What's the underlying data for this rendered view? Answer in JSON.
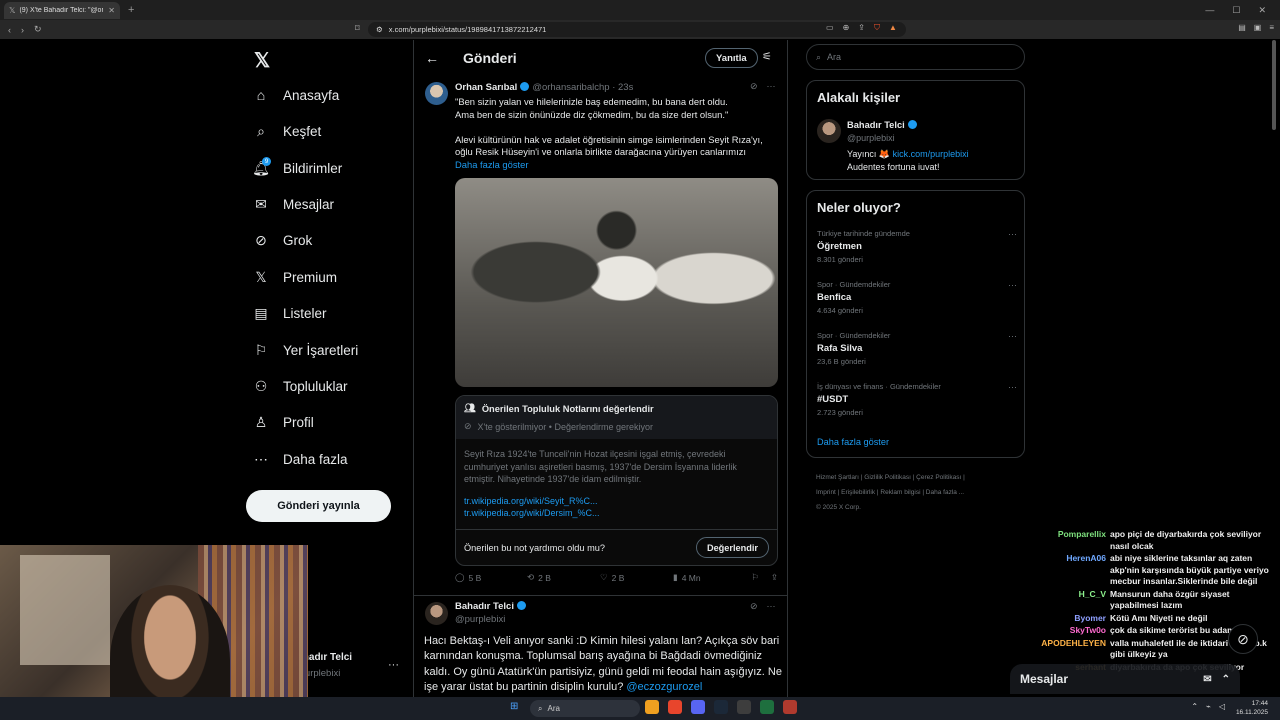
{
  "browser": {
    "tab_title": "(9) X'te Bahadır Telci: \"@orhansaribalchp ...",
    "url": "x.com/purplebixi/status/1989841713872212471"
  },
  "nav": {
    "items": [
      {
        "label": "Anasayfa",
        "icon": "home-icon"
      },
      {
        "label": "Keşfet",
        "icon": "search-icon"
      },
      {
        "label": "Bildirimler",
        "icon": "bell-icon",
        "badge": "9"
      },
      {
        "label": "Mesajlar",
        "icon": "mail-icon"
      },
      {
        "label": "Grok",
        "icon": "grok-icon"
      },
      {
        "label": "Premium",
        "icon": "x-logo-icon"
      },
      {
        "label": "Listeler",
        "icon": "list-icon"
      },
      {
        "label": "Yer İşaretleri",
        "icon": "bookmark-icon"
      },
      {
        "label": "Topluluklar",
        "icon": "communities-icon"
      },
      {
        "label": "Profil",
        "icon": "person-icon"
      },
      {
        "label": "Daha fazla",
        "icon": "more-circle-icon"
      }
    ],
    "post_button": "Gönderi yayınla",
    "account_name": "Bahadır Telci",
    "account_handle": "@purplebixi"
  },
  "main": {
    "header_title": "Gönderi",
    "reply_button": "Yanıtla",
    "tweet1": {
      "name": "Orhan Sarıbal",
      "handle": "@orhansaribalchp",
      "time": "23s",
      "text_line1": "\"Ben sizin yalan ve hilelerinizle baş edemedim, bu bana dert oldu.",
      "text_line2": "Ama ben de sizin önünüzde diz çökmedim, bu da size dert olsun.\"",
      "text_line3": "Alevi kültürünün hak ve adalet öğretisinin simge isimlerinden Seyit Rıza'yı,",
      "text_line4": "oğlu Resik Hüseyin'i ve onlarla birlikte darağacına yürüyen canlarımızı",
      "show_more": "Daha fazla göster"
    },
    "note": {
      "title": "Önerilen Topluluk Notlarını değerlendir",
      "subtitle": "X'te gösterilmiyor • Değerlendirme gerekiyor",
      "body_line1": "Seyit Rıza 1924'te Tunceli'nin Hozat ilçesini işgal etmiş, çevredeki",
      "body_line2": "cumhuriyet yanlısı aşiretleri basmış, 1937'de Dersim İsyanına liderlik",
      "body_line3": "etmiştir. Nihayetinde 1937'de idam edilmiştir.",
      "link1": "tr.wikipedia.org/wiki/Seyit_R%C...",
      "link2": "tr.wikipedia.org/wiki/Dersim_%C...",
      "question": "Önerilen bu not yardımcı oldu mu?",
      "rate_button": "Değerlendir"
    },
    "actions": {
      "replies": "5 B",
      "reposts": "2 B",
      "likes": "2 B",
      "views": "4 Mn"
    },
    "tweet2": {
      "name": "Bahadır Telci",
      "handle": "@purplebixi",
      "text": "Hacı Bektaş-ı Veli anıyor sanki :D Kimin hilesi yalanı lan? Açıkça söv bari karnından konuşma. Toplumsal barış ayağına bi Bağdadi övmediğiniz kaldı. Oy günü Atatürk'ün partisiyiz, günü geldi mi feodal hain aşığıyız. Ne işe yarar üstat bu partinin disiplin kurulu?",
      "mention": "@eczozgurozel"
    }
  },
  "right": {
    "search_placeholder": "Ara",
    "related_title": "Alakalı kişiler",
    "related": {
      "name": "Bahadır Telci",
      "handle": "@purplebixi",
      "bio_prefix": "Yayıncı 🦊",
      "bio_link": "kick.com/purplebixi",
      "bio_line2": "Audentes fortuna iuvat!"
    },
    "trends_title": "Neler oluyor?",
    "trends": [
      {
        "category": "Türkiye tarihinde gündemde",
        "name": "Öğretmen",
        "count": "8.301 gönderi"
      },
      {
        "category": "Spor · Gündemdekiler",
        "name": "Benfica",
        "count": "4.634 gönderi"
      },
      {
        "category": "Spor · Gündemdekiler",
        "name": "Rafa Silva",
        "count": "23,6 B gönderi"
      },
      {
        "category": "İş dünyası ve finans · Gündemdekiler",
        "name": "#USDT",
        "count": "2.723 gönderi"
      }
    ],
    "show_more": "Daha fazla göster",
    "footer_line1": "Hizmet Şartları  |  Gizlilik Politikası  |  Çerez Politikası  |",
    "footer_line2": "Imprint  |  Erişilebilirlik  |  Reklam bilgisi  |  Daha fazla ...",
    "footer_line3": "© 2025 X Corp."
  },
  "chat": [
    {
      "user": "Pomparellix",
      "color": "#7ee07e",
      "msg": "apo piçi de diyarbakırda çok seviliyor nasıl olcak"
    },
    {
      "user": "HerenA06",
      "color": "#6fa8ff",
      "msg": "abi niye siklerine taksınlar aq zaten akp'nin karşısında büyük partiye veriyo mecbur insanlar.Siklerinde bile değil"
    },
    {
      "user": "H_C_V",
      "color": "#8df28d",
      "msg": "Mansurun daha özgür siyaset yapabilmesi lazım"
    },
    {
      "user": "Byomer",
      "color": "#8fa0ff",
      "msg": "Kötü Amı Niyeti ne değil"
    },
    {
      "user": "SkyTw0o",
      "color": "#ff6bd0",
      "msg": "çok da sikime terörist bu adam"
    },
    {
      "user": "APODEHLEYEN",
      "color": "#ffb347",
      "msg": "valla muhalefetl ile de iktidari ile de b.k gibi ülkeyiz ya"
    },
    {
      "user": "serhant",
      "color": "#ffd27a",
      "msg": "diyarbakırda da apo çok seviliyor"
    }
  ],
  "messages_label": "Mesajlar",
  "taskbar": {
    "search": "Ara",
    "time": "17:44",
    "date": "16.11.2025"
  }
}
